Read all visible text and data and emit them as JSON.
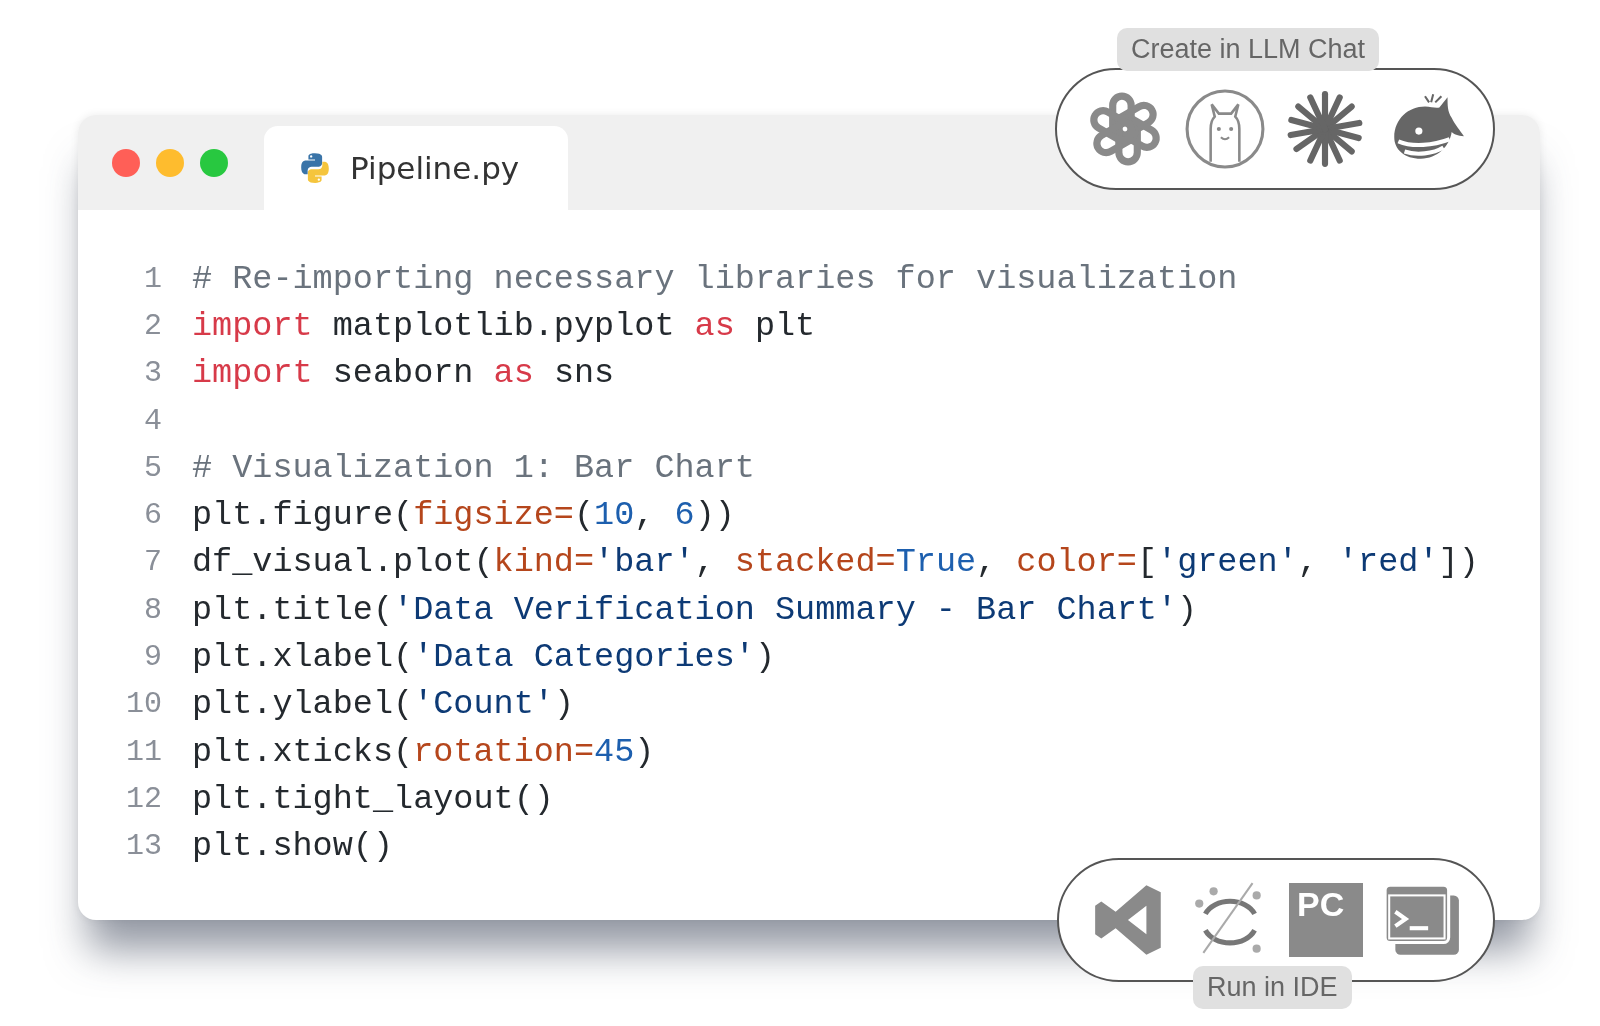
{
  "window": {
    "traffic_lights": [
      {
        "color": "#ff5f57"
      },
      {
        "color": "#febc2e"
      },
      {
        "color": "#28c840"
      }
    ]
  },
  "tabs": [
    {
      "label": "Pipeline.py",
      "selected": true
    }
  ],
  "code": {
    "lines": [
      {
        "number": "1",
        "tokens": [
          {
            "kind": "comment",
            "text": "# Re-importing necessary libraries for visualization"
          }
        ]
      },
      {
        "number": "2",
        "tokens": [
          {
            "kind": "keyword",
            "text": "import"
          },
          {
            "kind": "plain",
            "text": " matplotlib.pyplot "
          },
          {
            "kind": "keyword",
            "text": "as"
          },
          {
            "kind": "plain",
            "text": " plt"
          }
        ]
      },
      {
        "number": "3",
        "tokens": [
          {
            "kind": "keyword",
            "text": "import"
          },
          {
            "kind": "plain",
            "text": " seaborn "
          },
          {
            "kind": "keyword",
            "text": "as"
          },
          {
            "kind": "plain",
            "text": " sns"
          }
        ]
      },
      {
        "number": "4"
      },
      {
        "number": "5",
        "tokens": [
          {
            "kind": "comment",
            "text": "# Visualization 1: Bar Chart"
          }
        ]
      },
      {
        "number": "6",
        "tokens": [
          {
            "kind": "plain",
            "text": "plt.figure("
          },
          {
            "kind": "param",
            "text": "figsize="
          },
          {
            "kind": "plain",
            "text": "("
          },
          {
            "kind": "number",
            "text": "10"
          },
          {
            "kind": "plain",
            "text": ", "
          },
          {
            "kind": "number",
            "text": "6"
          },
          {
            "kind": "plain",
            "text": "))"
          }
        ]
      },
      {
        "number": "7",
        "tokens": [
          {
            "kind": "plain",
            "text": "df_visual.plot("
          },
          {
            "kind": "param",
            "text": "kind="
          },
          {
            "kind": "string",
            "text": "'bar'"
          },
          {
            "kind": "plain",
            "text": ", "
          },
          {
            "kind": "param",
            "text": "stacked="
          },
          {
            "kind": "number",
            "text": "True"
          },
          {
            "kind": "plain",
            "text": ", "
          },
          {
            "kind": "param",
            "text": "color="
          },
          {
            "kind": "plain",
            "text": "["
          },
          {
            "kind": "string",
            "text": "'green'"
          },
          {
            "kind": "plain",
            "text": ", "
          },
          {
            "kind": "string",
            "text": "'red'"
          },
          {
            "kind": "plain",
            "text": "])"
          }
        ]
      },
      {
        "number": "8",
        "tokens": [
          {
            "kind": "plain",
            "text": "plt.title("
          },
          {
            "kind": "string",
            "text": "'Data Verification Summary - Bar Chart'"
          },
          {
            "kind": "plain",
            "text": ")"
          }
        ]
      },
      {
        "number": "9",
        "tokens": [
          {
            "kind": "plain",
            "text": "plt.xlabel("
          },
          {
            "kind": "string",
            "text": "'Data Categories'"
          },
          {
            "kind": "plain",
            "text": ")"
          }
        ]
      },
      {
        "number": "10",
        "tokens": [
          {
            "kind": "plain",
            "text": "plt.ylabel("
          },
          {
            "kind": "string",
            "text": "'Count'"
          },
          {
            "kind": "plain",
            "text": ")"
          }
        ]
      },
      {
        "number": "11",
        "tokens": [
          {
            "kind": "plain",
            "text": "plt.xticks("
          },
          {
            "kind": "param",
            "text": "rotation="
          },
          {
            "kind": "number",
            "text": "45"
          },
          {
            "kind": "plain",
            "text": ")"
          }
        ]
      },
      {
        "number": "12",
        "tokens": [
          {
            "kind": "plain",
            "text": "plt.tight_layout()"
          }
        ]
      },
      {
        "number": "13",
        "tokens": [
          {
            "kind": "plain",
            "text": "plt.show()"
          }
        ]
      }
    ]
  },
  "llm_chat": {
    "label": "Create in LLM Chat"
  },
  "ide": {
    "label": "Run in IDE",
    "pc_badge": "PC"
  }
}
